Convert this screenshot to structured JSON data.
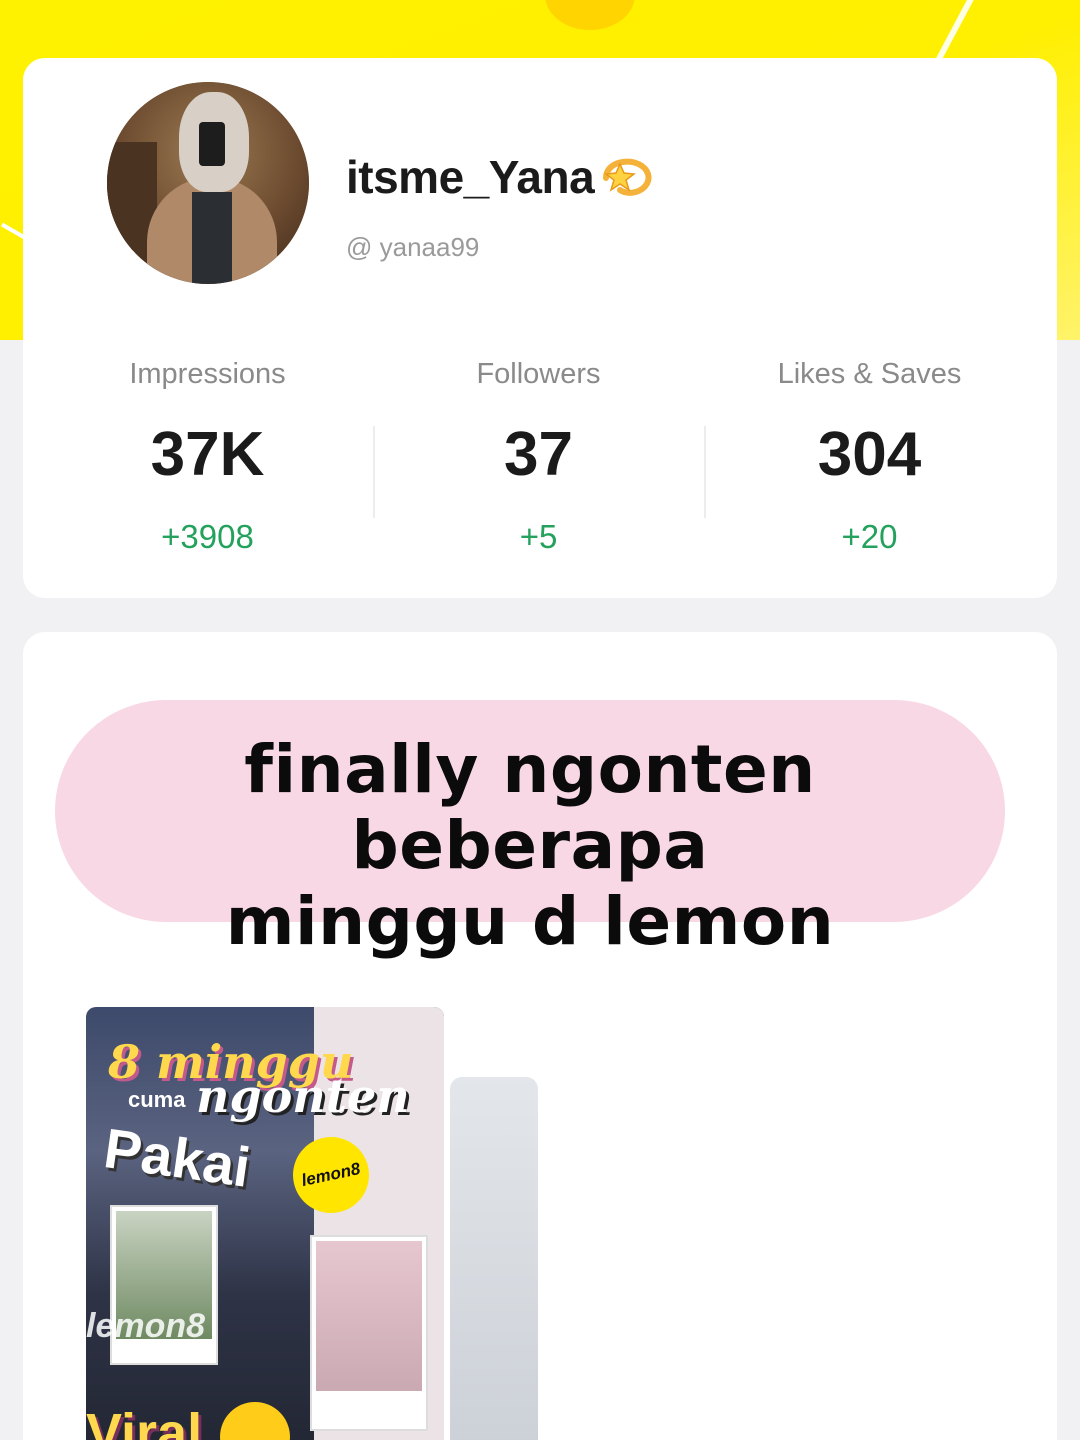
{
  "profile": {
    "username": "itsme_Yana",
    "username_emoji": "dizzy-sparkle-icon",
    "handle": "@ yanaa99"
  },
  "stats": [
    {
      "label": "Impressions",
      "value": "37K",
      "delta": "+3908"
    },
    {
      "label": "Followers",
      "value": "37",
      "delta": "+5"
    },
    {
      "label": "Likes & Saves",
      "value": "304",
      "delta": "+20"
    }
  ],
  "post": {
    "title_line1": "finally ngonten beberapa",
    "title_line2": "minggu d lemon",
    "thumbnail": {
      "line1": "8 minggu",
      "line2": "cuma",
      "line3": "ngonten",
      "line4": "Pakai",
      "badge": "lemon8",
      "watermark": "lemon8",
      "bottom_text": "Viral"
    }
  },
  "colors": {
    "background_top": "#fff200",
    "delta_green": "#24a25d",
    "title_pill": "#f9d8e6"
  }
}
